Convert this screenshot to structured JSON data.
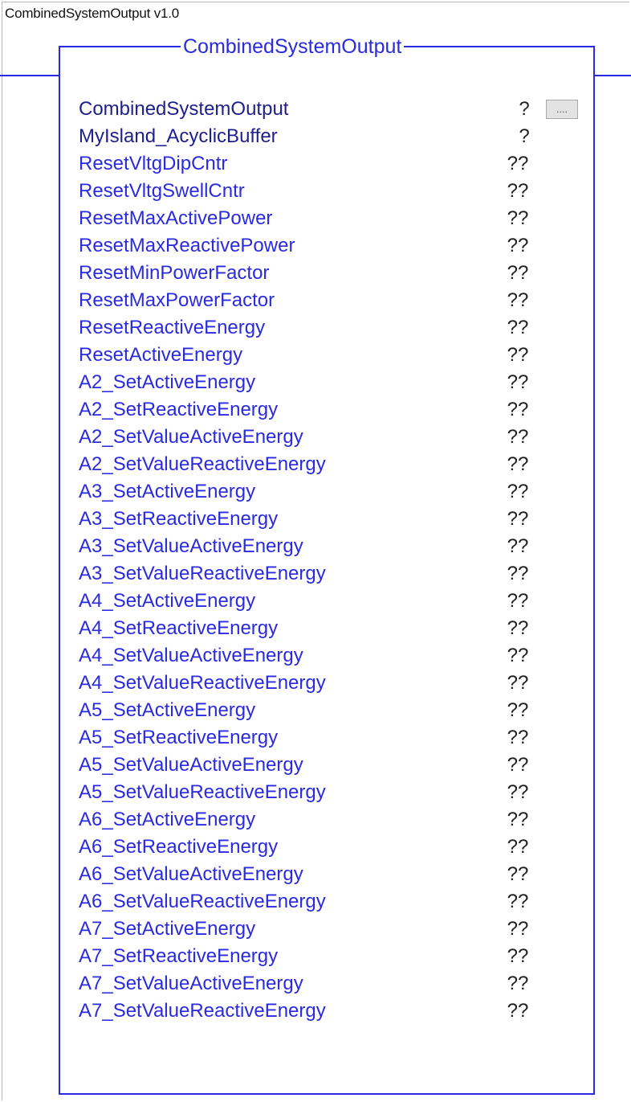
{
  "instruction": {
    "name_version": "CombinedSystemOutput v1.0",
    "block_title": "CombinedSystemOutput"
  },
  "colors": {
    "wire": "#2a2ae0",
    "tag_text": "#2a2ae0",
    "header_text": "#1e1e8c",
    "value_text": "#222222"
  },
  "rows": [
    {
      "label": "CombinedSystemOutput",
      "value": "?",
      "has_browse": true,
      "browse_label": "...."
    },
    {
      "label": "MyIsland_AcyclicBuffer",
      "value": "?"
    },
    {
      "label": "ResetVltgDipCntr",
      "value": "??"
    },
    {
      "label": "ResetVltgSwellCntr",
      "value": "??"
    },
    {
      "label": "ResetMaxActivePower",
      "value": "??"
    },
    {
      "label": "ResetMaxReactivePower",
      "value": "??"
    },
    {
      "label": "ResetMinPowerFactor",
      "value": "??"
    },
    {
      "label": "ResetMaxPowerFactor",
      "value": "??"
    },
    {
      "label": "ResetReactiveEnergy",
      "value": "??"
    },
    {
      "label": "ResetActiveEnergy",
      "value": "??"
    },
    {
      "label": "A2_SetActiveEnergy",
      "value": "??"
    },
    {
      "label": "A2_SetReactiveEnergy",
      "value": "??"
    },
    {
      "label": "A2_SetValueActiveEnergy",
      "value": "??"
    },
    {
      "label": "A2_SetValueReactiveEnergy",
      "value": "??"
    },
    {
      "label": "A3_SetActiveEnergy",
      "value": "??"
    },
    {
      "label": "A3_SetReactiveEnergy",
      "value": "??"
    },
    {
      "label": "A3_SetValueActiveEnergy",
      "value": "??"
    },
    {
      "label": "A3_SetValueReactiveEnergy",
      "value": "??"
    },
    {
      "label": "A4_SetActiveEnergy",
      "value": "??"
    },
    {
      "label": "A4_SetReactiveEnergy",
      "value": "??"
    },
    {
      "label": "A4_SetValueActiveEnergy",
      "value": "??"
    },
    {
      "label": "A4_SetValueReactiveEnergy",
      "value": "??"
    },
    {
      "label": "A5_SetActiveEnergy",
      "value": "??"
    },
    {
      "label": "A5_SetReactiveEnergy",
      "value": "??"
    },
    {
      "label": "A5_SetValueActiveEnergy",
      "value": "??"
    },
    {
      "label": "A5_SetValueReactiveEnergy",
      "value": "??"
    },
    {
      "label": "A6_SetActiveEnergy",
      "value": "??"
    },
    {
      "label": "A6_SetReactiveEnergy",
      "value": "??"
    },
    {
      "label": "A6_SetValueActiveEnergy",
      "value": "??"
    },
    {
      "label": "A6_SetValueReactiveEnergy",
      "value": "??"
    },
    {
      "label": "A7_SetActiveEnergy",
      "value": "??"
    },
    {
      "label": "A7_SetReactiveEnergy",
      "value": "??"
    },
    {
      "label": "A7_SetValueActiveEnergy",
      "value": "??"
    },
    {
      "label": "A7_SetValueReactiveEnergy",
      "value": "??"
    }
  ]
}
